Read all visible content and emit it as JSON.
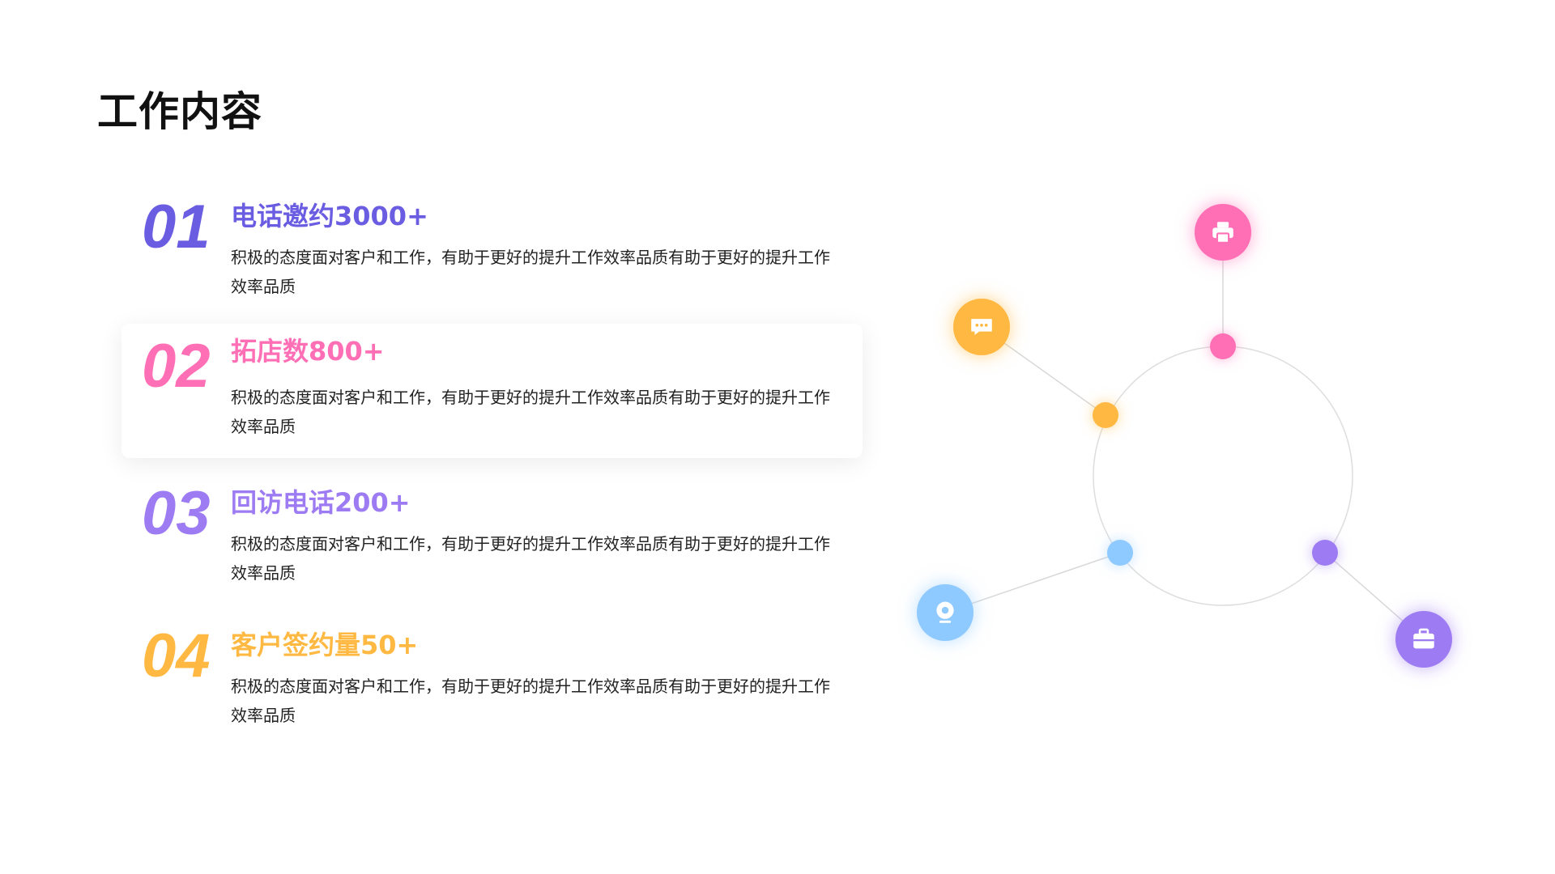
{
  "page": {
    "title": "工作内容"
  },
  "items": [
    {
      "num": "01",
      "heading": "电话邀约3000+",
      "desc": "积极的态度面对客户和工作，有助于更好的提升工作效率品质有助于更好的提升工作效率品质",
      "color": "#6A5DE1"
    },
    {
      "num": "02",
      "heading": "拓店数800+",
      "desc": "积极的态度面对客户和工作，有助于更好的提升工作效率品质有助于更好的提升工作效率品质",
      "color": "#FF6FB5"
    },
    {
      "num": "03",
      "heading": "回访电话200+",
      "desc": "积极的态度面对客户和工作，有助于更好的提升工作效率品质有助于更好的提升工作效率品质",
      "color": "#9D7BF2"
    },
    {
      "num": "04",
      "heading": "客户签约量50+",
      "desc": "积极的态度面对客户和工作，有助于更好的提升工作效率品质有助于更好的提升工作效率品质",
      "color": "#FFB942"
    }
  ],
  "diagram": {
    "nodes": [
      {
        "icon": "printer-icon",
        "color": "#FF6FB5"
      },
      {
        "icon": "chat-icon",
        "color": "#FFB942"
      },
      {
        "icon": "webcam-icon",
        "color": "#8EC9FF"
      },
      {
        "icon": "briefcase-icon",
        "color": "#9D7BF2"
      }
    ]
  }
}
